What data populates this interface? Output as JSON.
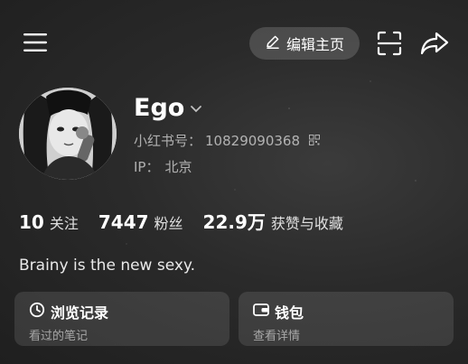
{
  "header": {
    "edit_profile_label": "编辑主页"
  },
  "profile": {
    "username": "Ego",
    "id_label": "小红书号：",
    "id_value": "10829090368",
    "ip_label": "IP：",
    "ip_value": "北京",
    "bio": "Brainy is the new sexy."
  },
  "stats": [
    {
      "number": "10",
      "label": "关注"
    },
    {
      "number": "7447",
      "label": "粉丝"
    },
    {
      "number": "22.9万",
      "label": "获赞与收藏"
    }
  ],
  "cards": [
    {
      "title": "浏览记录",
      "subtitle": "看过的笔记",
      "icon": "history-clock-icon"
    },
    {
      "title": "钱包",
      "subtitle": "查看详情",
      "icon": "wallet-icon"
    }
  ],
  "colors": {
    "background": "#2a2a2a",
    "text_primary": "#ffffff",
    "text_secondary": "#9e9e9e"
  }
}
